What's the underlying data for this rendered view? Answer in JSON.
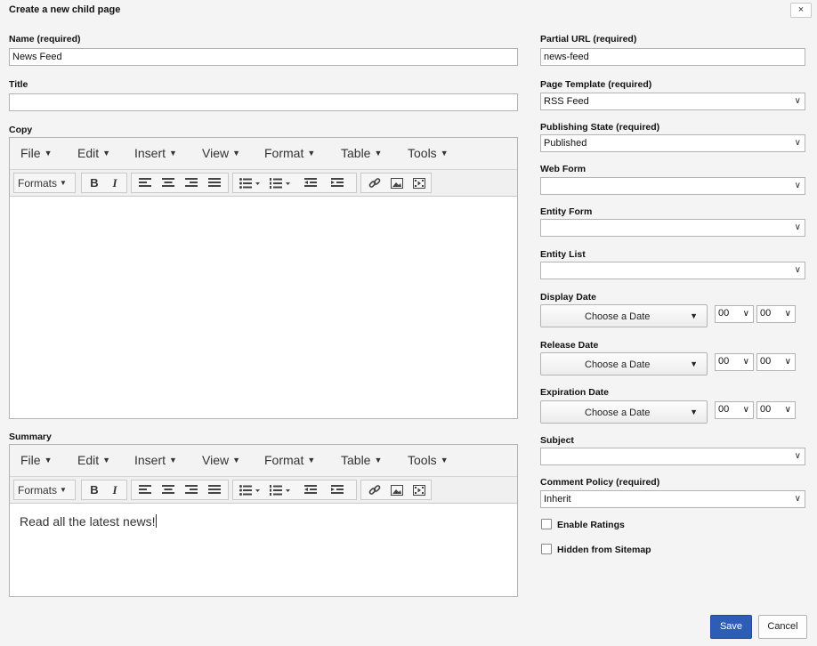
{
  "dialog": {
    "title": "Create a new child page",
    "close_label": "×"
  },
  "left": {
    "name_label": "Name (required)",
    "name_value": "News Feed",
    "title_label": "Title",
    "title_value": "",
    "copy_label": "Copy",
    "summary_label": "Summary"
  },
  "editor_menu": [
    {
      "label": "File"
    },
    {
      "label": "Edit"
    },
    {
      "label": "Insert"
    },
    {
      "label": "View"
    },
    {
      "label": "Format"
    },
    {
      "label": "Table"
    },
    {
      "label": "Tools"
    }
  ],
  "toolbar": {
    "formats": "Formats",
    "bold": "B",
    "italic": "I"
  },
  "copy_editor": {
    "content": ""
  },
  "summary_editor": {
    "content": "Read all the latest news!"
  },
  "right": {
    "partial_url_label": "Partial URL (required)",
    "partial_url_value": "news-feed",
    "page_template_label": "Page Template (required)",
    "page_template_value": "RSS Feed",
    "publishing_state_label": "Publishing State (required)",
    "publishing_state_value": "Published",
    "web_form_label": "Web Form",
    "web_form_value": "",
    "entity_form_label": "Entity Form",
    "entity_form_value": "",
    "entity_list_label": "Entity List",
    "entity_list_value": "",
    "display_date_label": "Display Date",
    "release_date_label": "Release Date",
    "expiration_date_label": "Expiration Date",
    "choose_date": "Choose a Date",
    "hour": "00",
    "minute": "00",
    "subject_label": "Subject",
    "subject_value": "",
    "comment_policy_label": "Comment Policy (required)",
    "comment_policy_value": "Inherit",
    "enable_ratings_label": "Enable Ratings",
    "hidden_sitemap_label": "Hidden from Sitemap"
  },
  "footer": {
    "save_label": "Save",
    "cancel_label": "Cancel"
  },
  "colors": {
    "primary": "#2e5db8",
    "border": "#b3b3b3",
    "background": "#f4f4f4"
  }
}
